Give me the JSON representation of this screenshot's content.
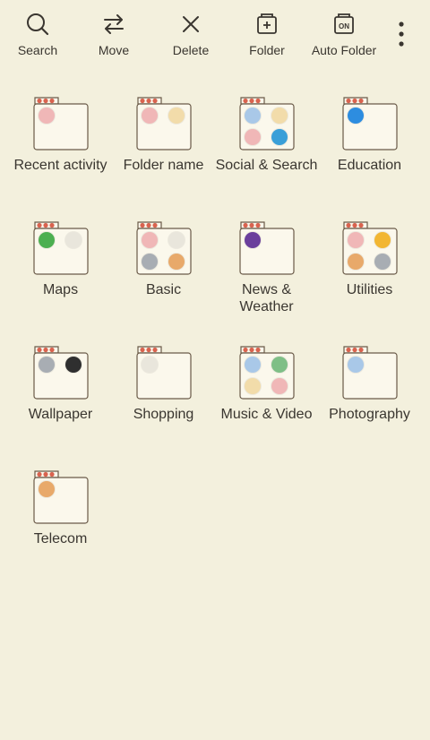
{
  "toolbar": {
    "search": {
      "label": "Search",
      "icon": "search-icon"
    },
    "move": {
      "label": "Move",
      "icon": "swap-arrows-icon"
    },
    "delete": {
      "label": "Delete",
      "icon": "close-icon"
    },
    "folder": {
      "label": "Folder",
      "icon": "add-folder-icon"
    },
    "auto_folder": {
      "label": "Auto Folder",
      "icon": "auto-folder-on-icon",
      "badge": "ON"
    },
    "more": {
      "icon": "more-vert-icon"
    }
  },
  "folders": [
    {
      "label": "Recent activity",
      "icons": [
        "cat-pink"
      ]
    },
    {
      "label": "Folder name",
      "icons": [
        "cat-pink",
        "cat-cream"
      ]
    },
    {
      "label": "Social & Search",
      "icons": [
        "cat-blue",
        "cat-cream",
        "cat-pink",
        "telegram"
      ]
    },
    {
      "label": "Education",
      "icons": [
        "play-store"
      ]
    },
    {
      "label": "Maps",
      "icons": [
        "google-maps",
        "cat-white"
      ]
    },
    {
      "label": "Basic",
      "icons": [
        "cat-pink",
        "cat-white",
        "cat-grey",
        "cat-orange"
      ]
    },
    {
      "label": "News & Weather",
      "icons": [
        "news-purple"
      ]
    },
    {
      "label": "Utilities",
      "icons": [
        "cat-pink",
        "drive",
        "cat-orange",
        "cat-grey"
      ]
    },
    {
      "label": "Wallpaper",
      "icons": [
        "cat-grey",
        "wallpaper-dark"
      ]
    },
    {
      "label": "Shopping",
      "icons": [
        "cat-white"
      ]
    },
    {
      "label": "Music & Video",
      "icons": [
        "cat-blue",
        "cat-green",
        "cat-cream",
        "cat-pink"
      ]
    },
    {
      "label": "Photography",
      "icons": [
        "cat-blue"
      ]
    },
    {
      "label": "Telecom",
      "icons": [
        "cat-orange"
      ]
    }
  ],
  "colors": {
    "background": "#f3f0dd",
    "folder_fill": "#fbf8ec",
    "folder_outline": "#6a5a48",
    "folder_tab_hearts": "#d9634f"
  }
}
